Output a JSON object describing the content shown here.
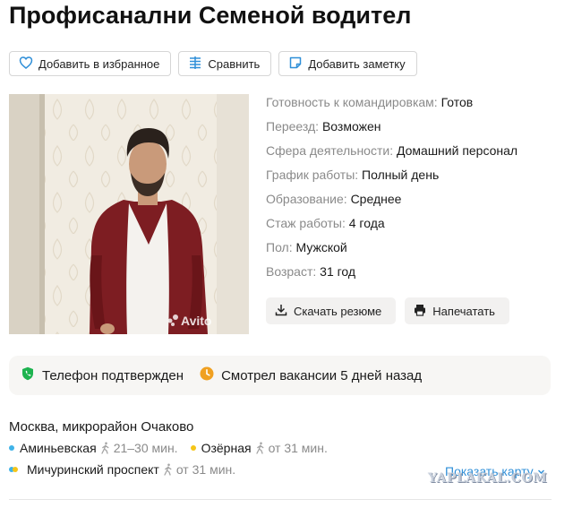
{
  "page_title": "Профисанални Семеной водител",
  "actions": {
    "favorite": "Добавить в избранное",
    "compare": "Сравнить",
    "note": "Добавить заметку"
  },
  "photo": {
    "watermark_text": "Avito"
  },
  "info": [
    {
      "key": "Готовность к командировкам:",
      "value": "Готов"
    },
    {
      "key": "Переезд:",
      "value": "Возможен"
    },
    {
      "key": "Сфера деятельности:",
      "value": "Домашний персонал"
    },
    {
      "key": "График работы:",
      "value": "Полный день"
    },
    {
      "key": "Образование:",
      "value": "Среднее"
    },
    {
      "key": "Стаж работы:",
      "value": "4 года"
    },
    {
      "key": "Пол:",
      "value": "Мужской"
    },
    {
      "key": "Возраст:",
      "value": "31 год"
    }
  ],
  "doc_actions": {
    "download": "Скачать резюме",
    "print": "Напечатать"
  },
  "status": {
    "phone": "Телефон подтвержден",
    "viewed": "Смотрел вакансии 5 дней назад"
  },
  "location": "Москва, микрорайон Очаково",
  "metro": [
    {
      "name": "Аминьевская",
      "time": "21–30 мин.",
      "color": "#3fb3e8"
    },
    {
      "name": "Озёрная",
      "time": "от 31 мин.",
      "color": "#f5c518"
    },
    {
      "name": "Мичуринский проспект",
      "time": "от 31 мин.",
      "color": "#3fb3e8",
      "color2": "#f5c518"
    }
  ],
  "show_map": "Показать карту",
  "watermark": "YAPLAKAL.COM",
  "colors": {
    "link": "#2f8fd8",
    "phone_verified": "#1db34f",
    "recent_activity": "#f0a020"
  }
}
